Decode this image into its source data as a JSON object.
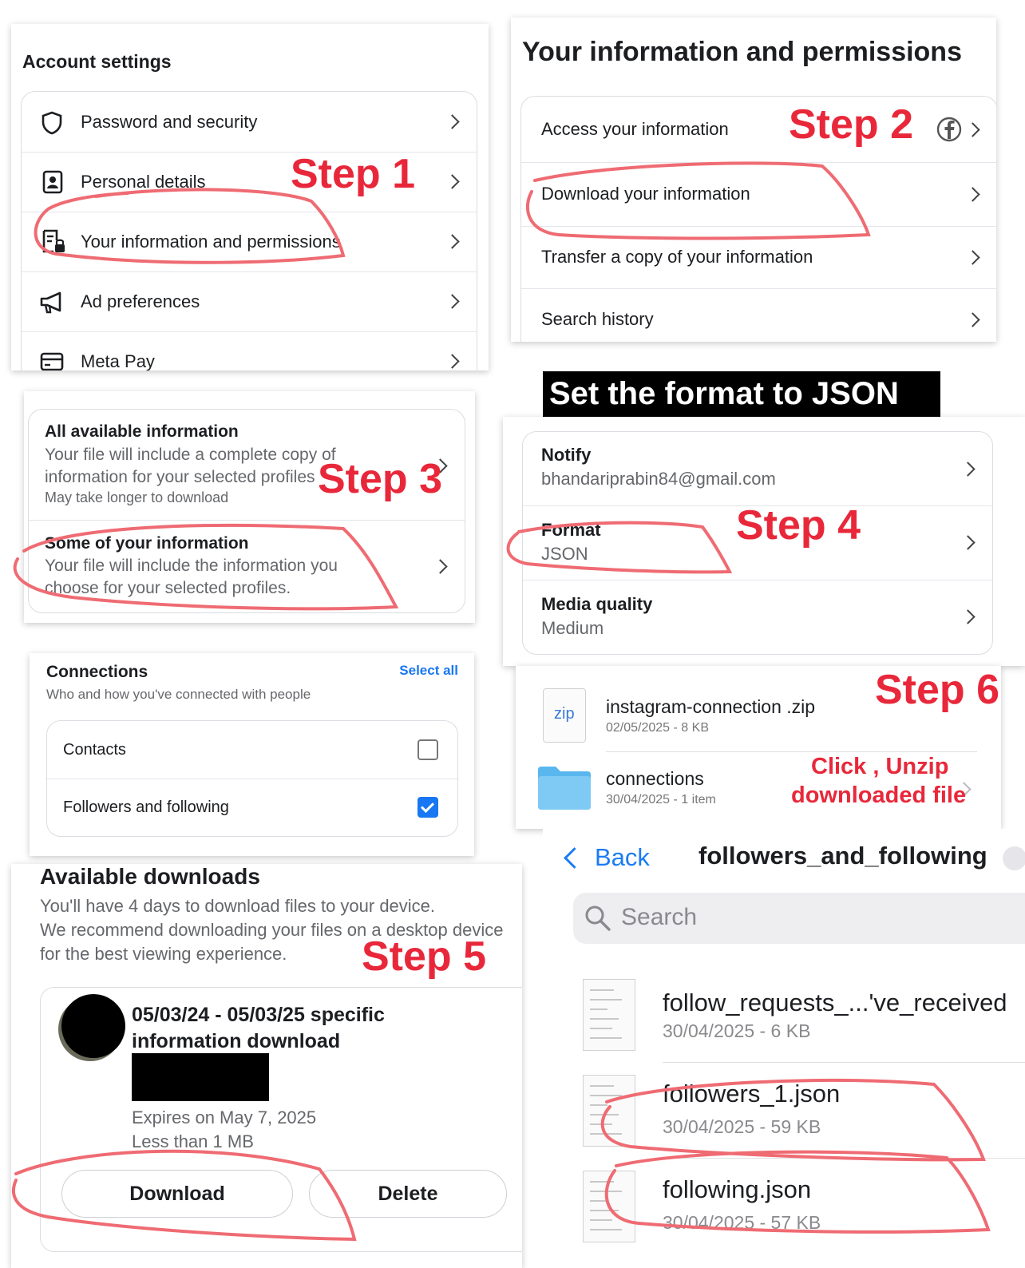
{
  "panel1": {
    "title": "Account settings",
    "items": [
      {
        "label": "Password and security",
        "icon": "shield-icon"
      },
      {
        "label": "Personal details",
        "icon": "id-card-icon"
      },
      {
        "label": "Your information and permissions",
        "icon": "document-lock-icon"
      },
      {
        "label": "Ad preferences",
        "icon": "megaphone-icon"
      },
      {
        "label": "Meta Pay",
        "icon": "card-icon"
      }
    ]
  },
  "panel2": {
    "title": "Your information and permissions",
    "items": [
      {
        "label": "Access your information"
      },
      {
        "label": "Download your information"
      },
      {
        "label": "Transfer a copy of your information"
      },
      {
        "label": "Search history"
      }
    ]
  },
  "panel3": {
    "all_title": "All available information",
    "all_desc": "Your file will include a complete copy of information for your selected profiles",
    "all_note": "May take longer to download",
    "some_title": "Some of your information",
    "some_desc": "Your file will include the information you choose for your selected profiles."
  },
  "format_banner": "Set the format to JSON",
  "panel4": {
    "notify_label": "Notify",
    "notify_value": "bhandariprabin84@gmail.com",
    "format_label": "Format",
    "format_value": "JSON",
    "media_label": "Media quality",
    "media_value": "Medium"
  },
  "panel5": {
    "title": "Connections",
    "select_all": "Select all",
    "desc": "Who and how you've connected with people",
    "options": [
      {
        "label": "Contacts",
        "checked": false
      },
      {
        "label": "Followers and following",
        "checked": true
      }
    ]
  },
  "panel6": {
    "zip_badge": "zip",
    "zip_name": "instagram-connection .zip",
    "zip_meta": "02/05/2025 - 8 KB",
    "folder_name": "connections",
    "folder_meta": "30/04/2025 - 1 item",
    "hint_line1": "Click , Unzip",
    "hint_line2": "downloaded file"
  },
  "panel7": {
    "title": "Available downloads",
    "desc1": "You'll have 4 days to download files to your device.",
    "desc2": "We recommend downloading your files on a desktop device",
    "desc3": "for the best viewing experience.",
    "item_title_1": "05/03/24 - 05/03/25 specific",
    "item_title_2": "information download",
    "expires": "Expires on May 7, 2025",
    "size": "Less than 1 MB",
    "download": "Download",
    "delete": "Delete"
  },
  "panel8": {
    "back": "Back",
    "folder_title": "followers_and_following",
    "search_placeholder": "Search",
    "files": [
      {
        "name": "follow_requests_...'ve_received",
        "meta": "30/04/2025 - 6 KB"
      },
      {
        "name": "followers_1.json",
        "meta": "30/04/2025 - 59 KB"
      },
      {
        "name": "following.json",
        "meta": "30/04/2025 - 57 KB"
      }
    ]
  },
  "steps": {
    "s1": "Step 1",
    "s2": "Step 2",
    "s3": "Step 3",
    "s4": "Step 4",
    "s5": "Step 5",
    "s6": "Step 6"
  },
  "colors": {
    "step_red": "#e8283a",
    "annotation": "#ef6b73",
    "link_blue": "#1877f2",
    "ios_blue": "#1a7cf5"
  }
}
